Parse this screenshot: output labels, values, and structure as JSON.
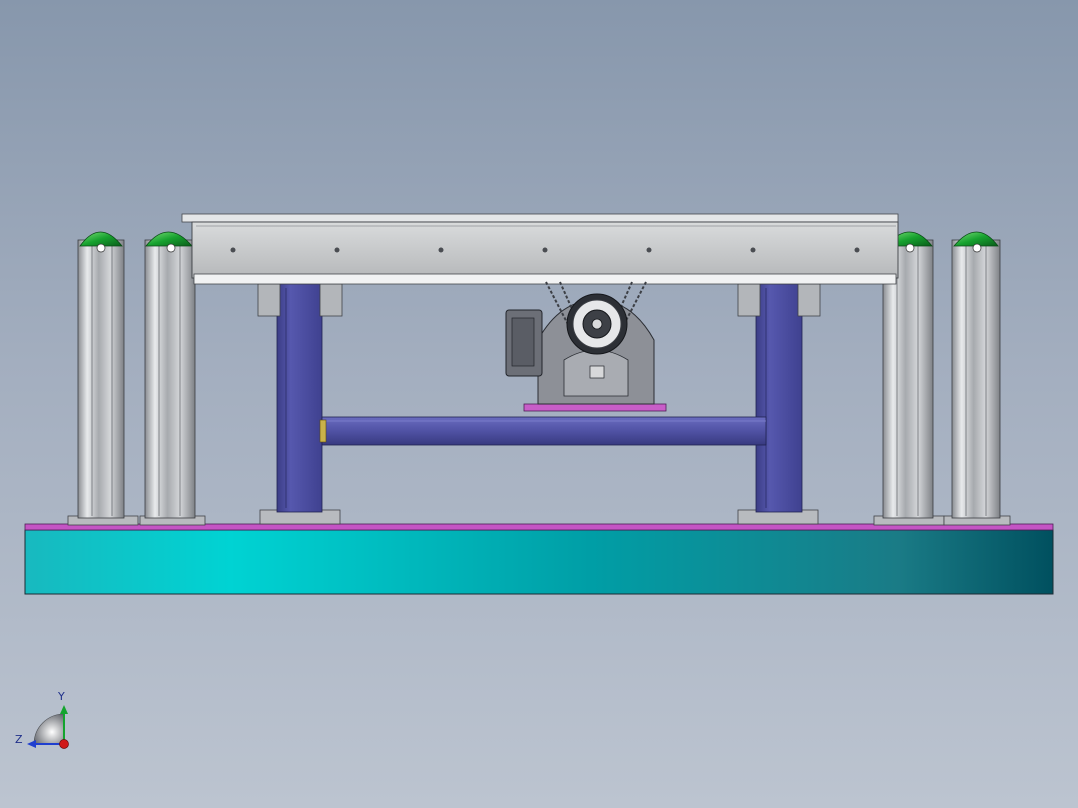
{
  "triad": {
    "y_label": "Y",
    "z_label": "Z"
  },
  "colors": {
    "background_top": "#8797ac",
    "background_bottom": "#bcc4d0",
    "base_plate_light": "#00d3d3",
    "base_plate_dark": "#005a6a",
    "base_top_strip": "#c454c4",
    "frame_blue": "#5052a4",
    "post_grey": "#c8cbd0",
    "post_cap_green": "#14a42e",
    "conveyor_grey": "#c8cacb",
    "axis_y": "#14a42e",
    "axis_z": "#1f3fcf",
    "axis_origin": "#d01818"
  }
}
